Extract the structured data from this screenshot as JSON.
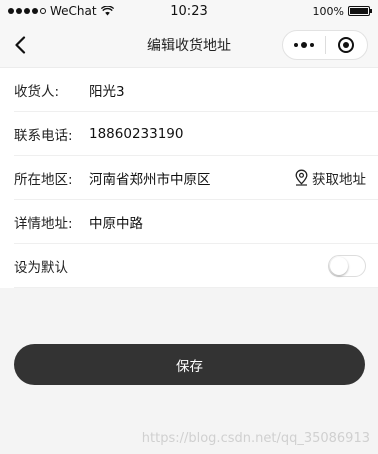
{
  "status_bar": {
    "carrier": "WeChat",
    "time": "10:23",
    "battery_percent": "100%",
    "battery_level": 1.0,
    "signal_icon": "signal-icon",
    "wifi_icon": "wifi-icon"
  },
  "nav": {
    "title": "编辑收货地址",
    "back_icon": "chevron-left-icon",
    "menu_icon": "more-dots-icon",
    "close_icon": "target-close-icon"
  },
  "form": {
    "receiver": {
      "label": "收货人:",
      "value": "阳光3"
    },
    "phone": {
      "label": "联系电话:",
      "value": "18860233190"
    },
    "region": {
      "label": "所在地区:",
      "value": "河南省郑州市中原区",
      "locate_label": "获取地址",
      "locate_icon": "location-pin-icon"
    },
    "detail": {
      "label": "详情地址:",
      "value": "中原中路"
    },
    "default": {
      "label": "设为默认",
      "checked": false
    }
  },
  "save_button": {
    "label": "保存",
    "color": "#333333"
  },
  "watermark": "https://blog.csdn.net/qq_35086913"
}
